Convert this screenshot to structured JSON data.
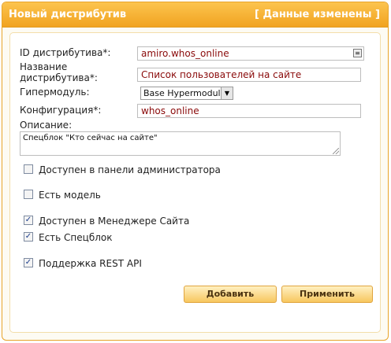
{
  "header": {
    "title": "Новый дистрибутив",
    "status": "[ Данные изменены ]"
  },
  "form": {
    "id_label": "ID дистрибутива*:",
    "id_value": "amiro.whos_online",
    "name_label_line1": "Название",
    "name_label_line2": "дистрибутива*:",
    "name_value": "Список пользователей на сайте",
    "hypermodule_label": "Гипермодуль:",
    "hypermodule_value": "Base Hypermodule",
    "config_label": "Конфигурация*:",
    "config_value": "whos_online",
    "description_label": "Описание:",
    "description_value": "Спецблок \"Кто сейчас на сайте\""
  },
  "checkboxes": [
    {
      "label": "Доступен в панели администратора",
      "checked": false
    },
    {
      "label": "Есть модель",
      "checked": false
    },
    {
      "label": "Доступен в Менеджере Сайта",
      "checked": true
    },
    {
      "label": "Есть Спецблок",
      "checked": true
    },
    {
      "label": "Поддержка REST API",
      "checked": true
    }
  ],
  "buttons": {
    "add": "Добавить",
    "apply": "Применить"
  },
  "colors": {
    "accent": "#f1a321",
    "input_text": "#8a0a0a"
  }
}
